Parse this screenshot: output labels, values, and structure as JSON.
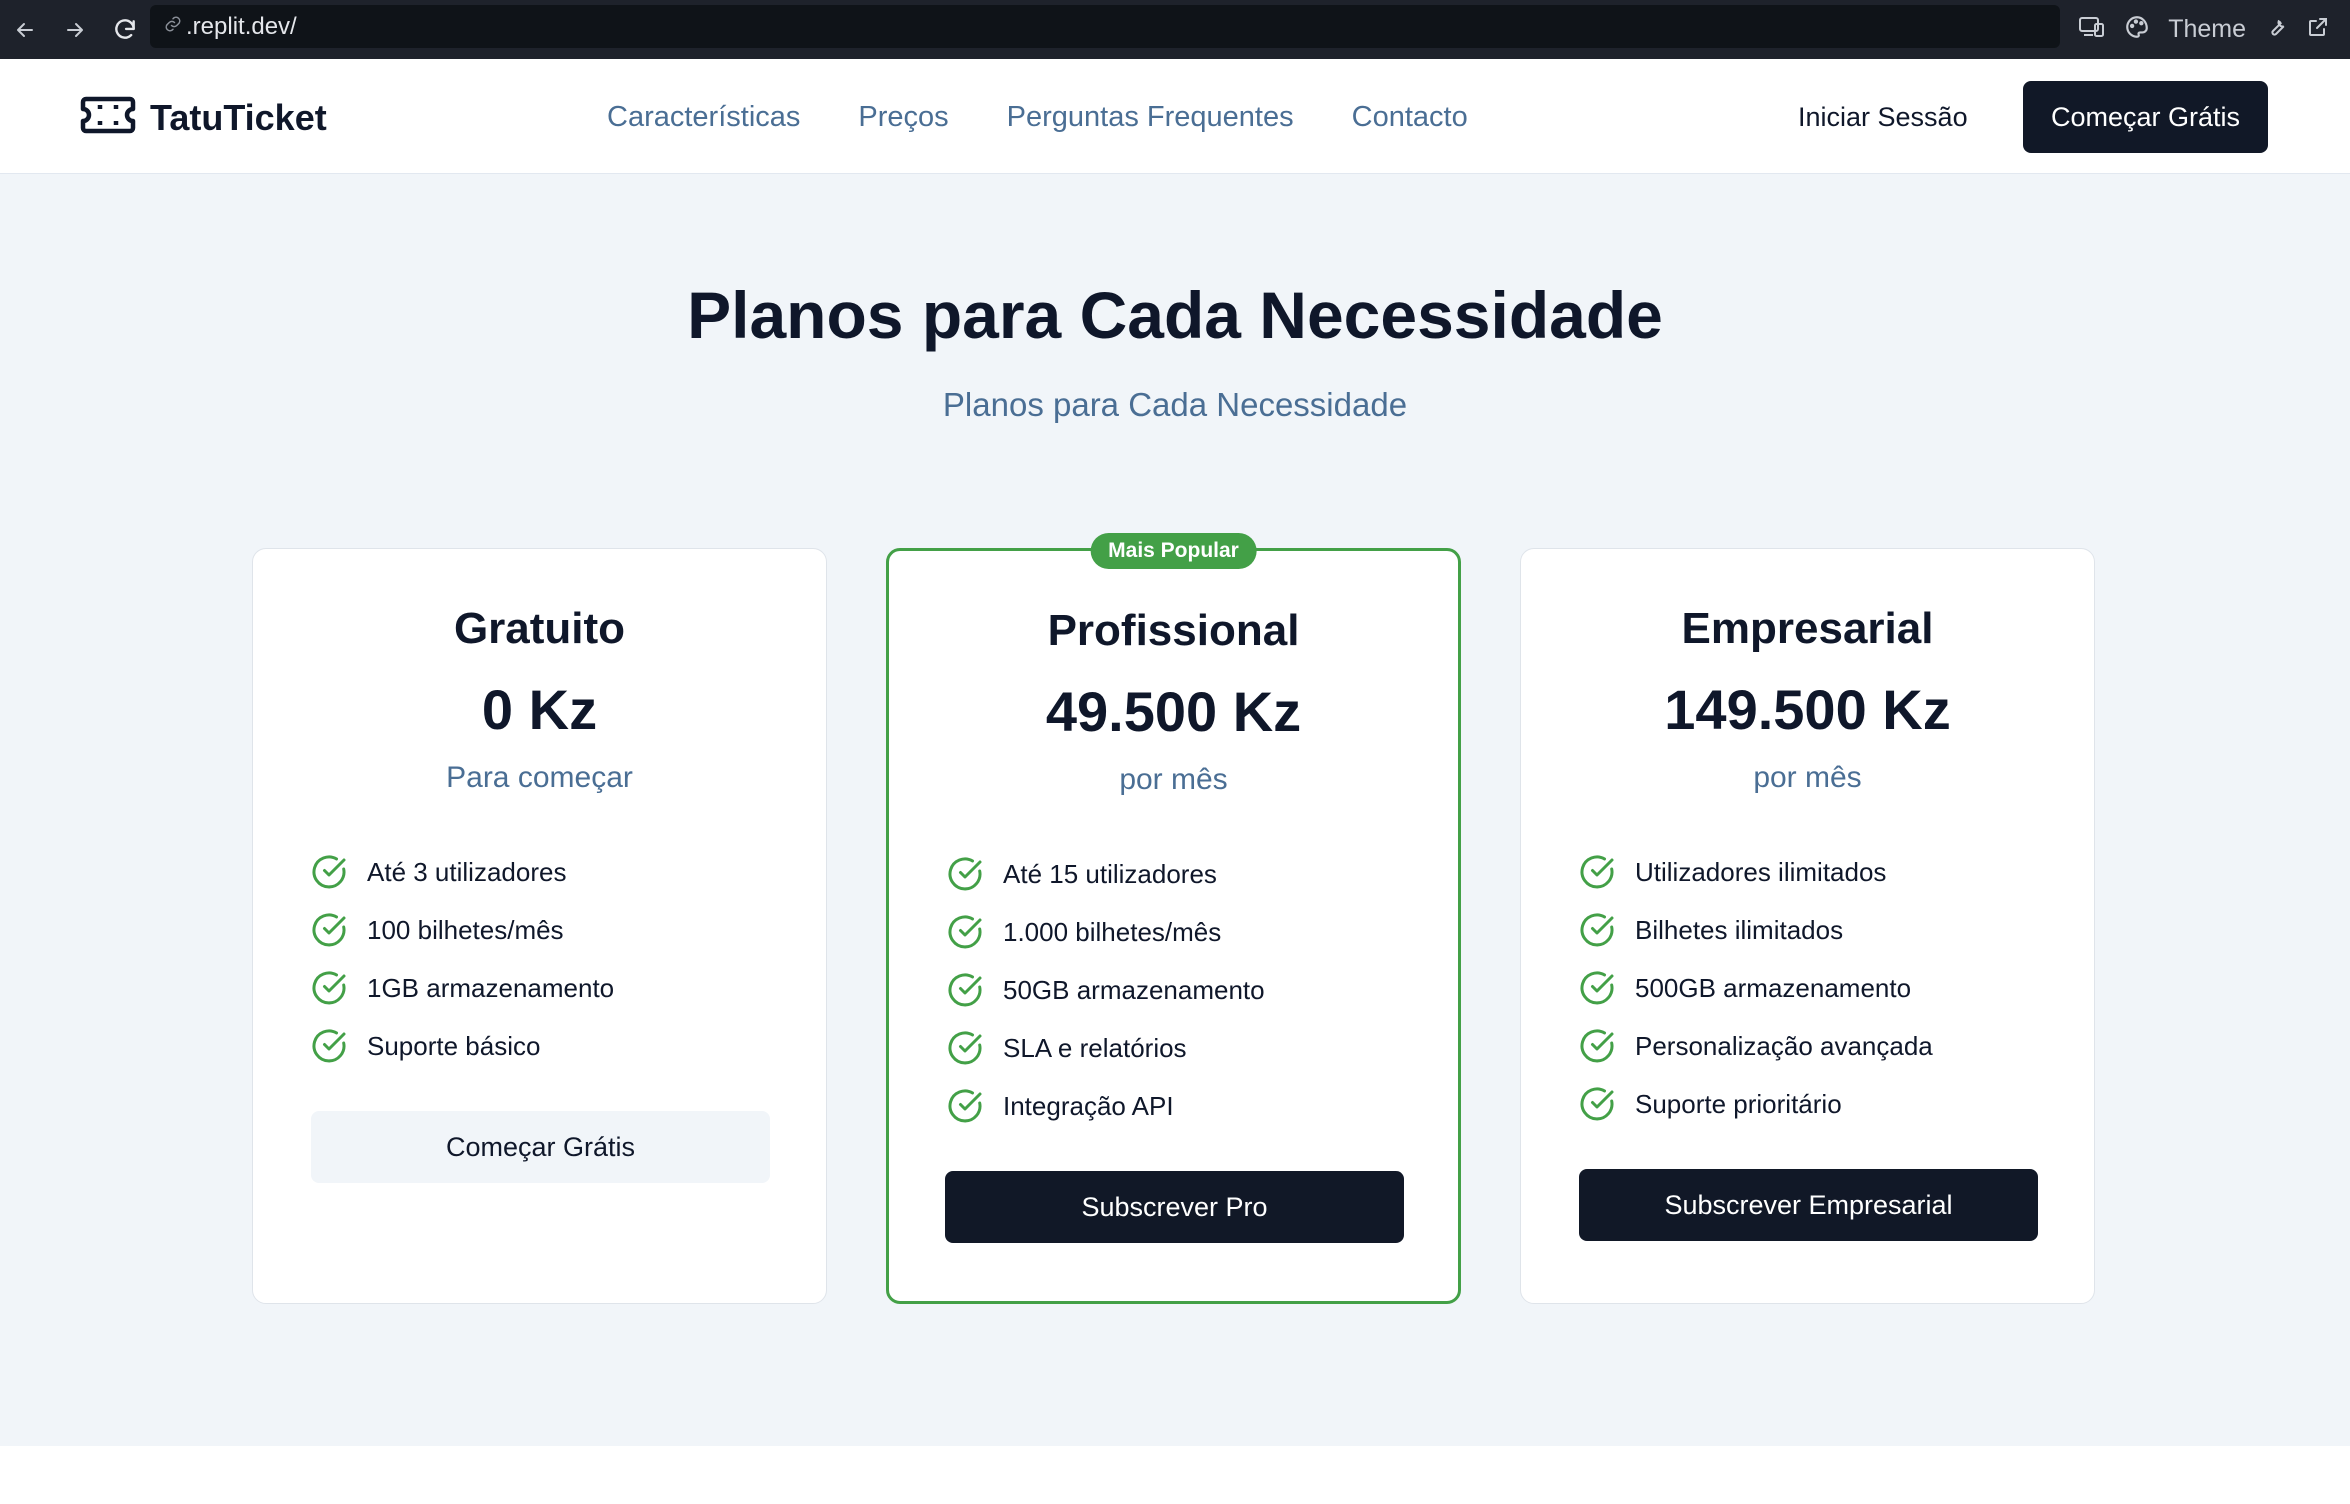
{
  "browser": {
    "url": ".replit.dev/",
    "theme_label": "Theme"
  },
  "header": {
    "brand": "TatuTicket",
    "nav": [
      "Características",
      "Preços",
      "Perguntas Frequentes",
      "Contacto"
    ],
    "login": "Iniciar Sessão",
    "cta": "Começar Grátis"
  },
  "hero": {
    "title": "Planos para Cada Necessidade",
    "subtitle": "Planos para Cada Necessidade"
  },
  "plans": [
    {
      "name": "Gratuito",
      "price": "0 Kz",
      "period": "Para começar",
      "features": [
        "Até 3 utilizadores",
        "100 bilhetes/mês",
        "1GB armazenamento",
        "Suporte básico"
      ],
      "button": "Começar Grátis"
    },
    {
      "badge": "Mais Popular",
      "name": "Profissional",
      "price": "49.500 Kz",
      "period": "por mês",
      "features": [
        "Até 15 utilizadores",
        "1.000 bilhetes/mês",
        "50GB armazenamento",
        "SLA e relatórios",
        "Integração API"
      ],
      "button": "Subscrever Pro"
    },
    {
      "name": "Empresarial",
      "price": "149.500 Kz",
      "period": "por mês",
      "features": [
        "Utilizadores ilimitados",
        "Bilhetes ilimitados",
        "500GB armazenamento",
        "Personalização avançada",
        "Suporte prioritário"
      ],
      "button": "Subscrever Empresarial"
    }
  ],
  "colors": {
    "accent_green": "#43a047",
    "dark": "#111827",
    "muted_blue": "#4a6e94",
    "background": "#f1f5f9"
  },
  "icons": {
    "check": "check-circle-icon",
    "logo": "ticket-icon"
  }
}
